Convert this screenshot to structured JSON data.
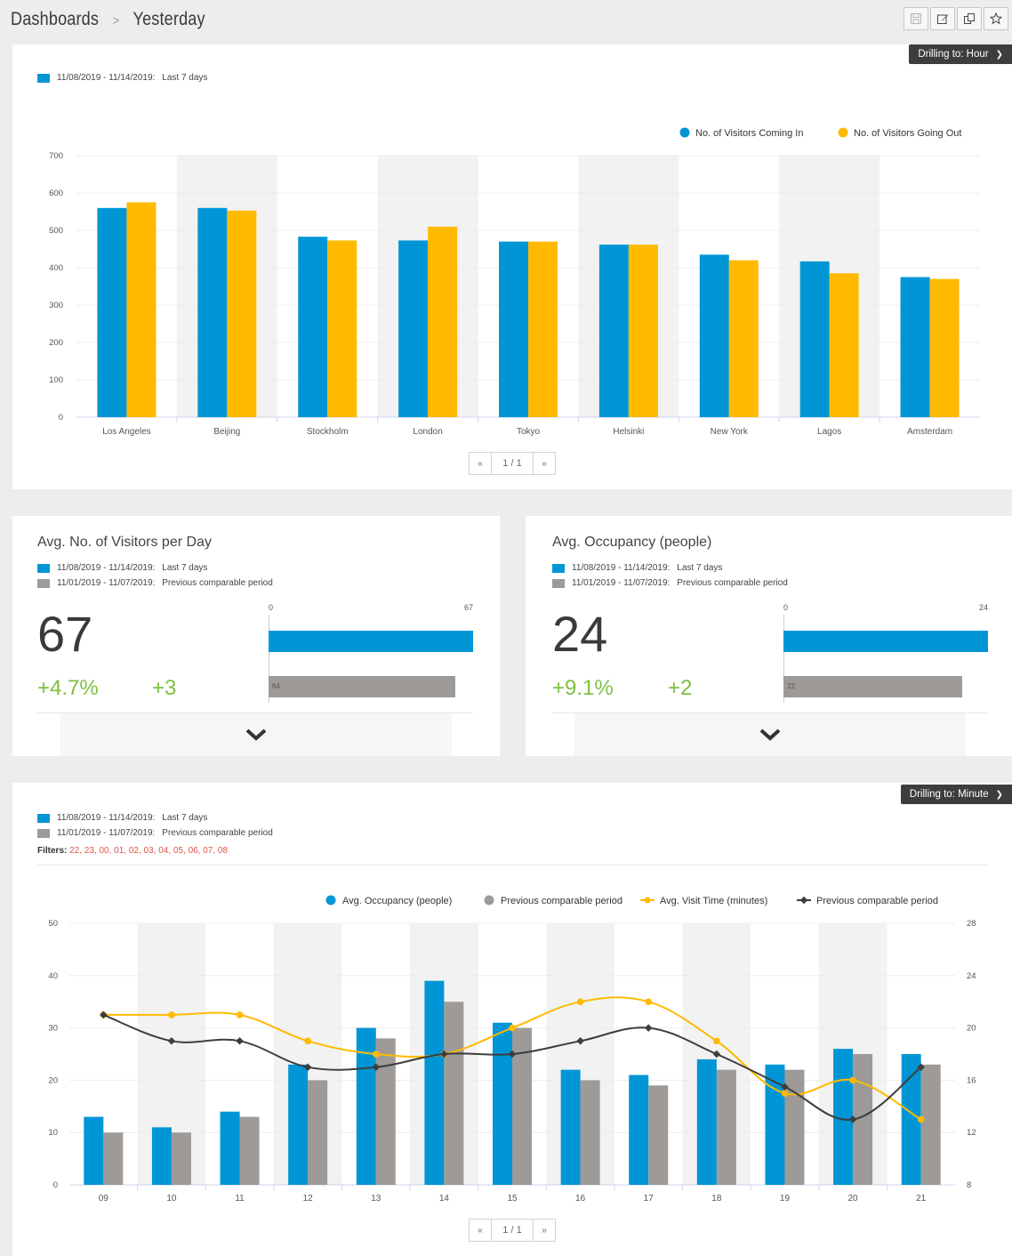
{
  "breadcrumb": {
    "root": "Dashboards",
    "separator": ">",
    "current": "Yesterday"
  },
  "toolbar": {
    "icons": [
      "save-icon",
      "edit-icon",
      "duplicate-icon",
      "star-icon"
    ]
  },
  "colors": {
    "blue": "#0096d6",
    "yellow": "#ffba00",
    "gray": "#9e9a98",
    "green": "#7dc043",
    "red": "#e0534a",
    "dark": "#3d3d3d"
  },
  "panel1": {
    "drill_label": "Drilling to: Hour",
    "legend_range": "11/08/2019 - 11/14/2019:",
    "legend_period": "Last 7 days",
    "pager": {
      "prev": "«",
      "page": "1 / 1",
      "next": "»"
    }
  },
  "card1": {
    "title": "Avg. No. of Visitors per Day",
    "legend": [
      {
        "range": "11/08/2019 - 11/14/2019:",
        "period": "Last 7 days"
      },
      {
        "range": "11/01/2019 - 11/07/2019:",
        "period": "Previous comparable period"
      }
    ],
    "value": "67",
    "pct_change": "+4.7%",
    "abs_change": "+3",
    "scale_min": "0",
    "scale_max": "67",
    "current": 67,
    "previous": 64,
    "previous_label": "64"
  },
  "card2": {
    "title": "Avg. Occupancy (people)",
    "legend": [
      {
        "range": "11/08/2019 - 11/14/2019:",
        "period": "Last 7 days"
      },
      {
        "range": "11/01/2019 - 11/07/2019:",
        "period": "Previous comparable period"
      }
    ],
    "value": "24",
    "pct_change": "+9.1%",
    "abs_change": "+2",
    "scale_min": "0",
    "scale_max": "24",
    "current": 24,
    "previous": 22,
    "previous_label": "22"
  },
  "panel3": {
    "drill_label": "Drilling to: Minute",
    "legend": [
      {
        "range": "11/08/2019 - 11/14/2019:",
        "period": "Last 7 days"
      },
      {
        "range": "11/01/2019 - 11/07/2019:",
        "period": "Previous comparable period"
      }
    ],
    "filters_label": "Filters:",
    "filters_values": "22, 23, 00, 01, 02, 03, 04, 05, 06, 07, 08",
    "pager": {
      "prev": "«",
      "page": "1 / 1",
      "next": "»"
    }
  },
  "chart_data": [
    {
      "type": "bar",
      "categories": [
        "Los Angeles",
        "Beijing",
        "Stockholm",
        "London",
        "Tokyo",
        "Helsinki",
        "New York",
        "Lagos",
        "Amsterdam"
      ],
      "series": [
        {
          "name": "No. of Visitors Coming In",
          "color": "#0096d6",
          "values": [
            560,
            560,
            483,
            473,
            470,
            462,
            435,
            417,
            375
          ]
        },
        {
          "name": "No. of Visitors Going Out",
          "color": "#ffba00",
          "values": [
            575,
            553,
            473,
            510,
            470,
            462,
            420,
            385,
            370
          ]
        }
      ],
      "yticks": [
        0,
        100,
        200,
        300,
        400,
        500,
        600,
        700
      ],
      "ylim": [
        0,
        700
      ],
      "legend_position": "top-right",
      "grid": true
    },
    {
      "type": "bar",
      "categories": [
        "09",
        "10",
        "11",
        "12",
        "13",
        "14",
        "15",
        "16",
        "17",
        "18",
        "19",
        "20",
        "21"
      ],
      "series": [
        {
          "name": "Avg. Occupancy (people)",
          "kind": "bar",
          "axis": "left",
          "color": "#0096d6",
          "values": [
            13,
            11,
            14,
            23,
            30,
            39,
            31,
            22,
            21,
            24,
            23,
            26,
            25
          ]
        },
        {
          "name": "Previous comparable period",
          "kind": "bar",
          "axis": "left",
          "color": "#9e9a98",
          "values": [
            10,
            10,
            13,
            20,
            28,
            35,
            30,
            20,
            19,
            22,
            22,
            25,
            23
          ]
        },
        {
          "name": "Avg. Visit Time (minutes)",
          "kind": "line",
          "axis": "right",
          "color": "#ffba00",
          "values": [
            21,
            21,
            21,
            19,
            18,
            18,
            20,
            22,
            22,
            19,
            15,
            16,
            13
          ]
        },
        {
          "name": "Previous comparable period",
          "kind": "line",
          "axis": "right",
          "color": "#3d3d3d",
          "values": [
            21,
            19,
            19,
            17,
            17,
            18,
            18,
            19,
            20,
            18,
            15.5,
            13,
            17
          ]
        }
      ],
      "yticks_left": [
        0,
        10,
        20,
        30,
        40,
        50
      ],
      "ylim_left": [
        0,
        50
      ],
      "yticks_right": [
        8,
        12,
        16,
        20,
        24,
        28
      ],
      "ylim_right": [
        8,
        28
      ],
      "legend_position": "top-right",
      "grid": true
    }
  ]
}
